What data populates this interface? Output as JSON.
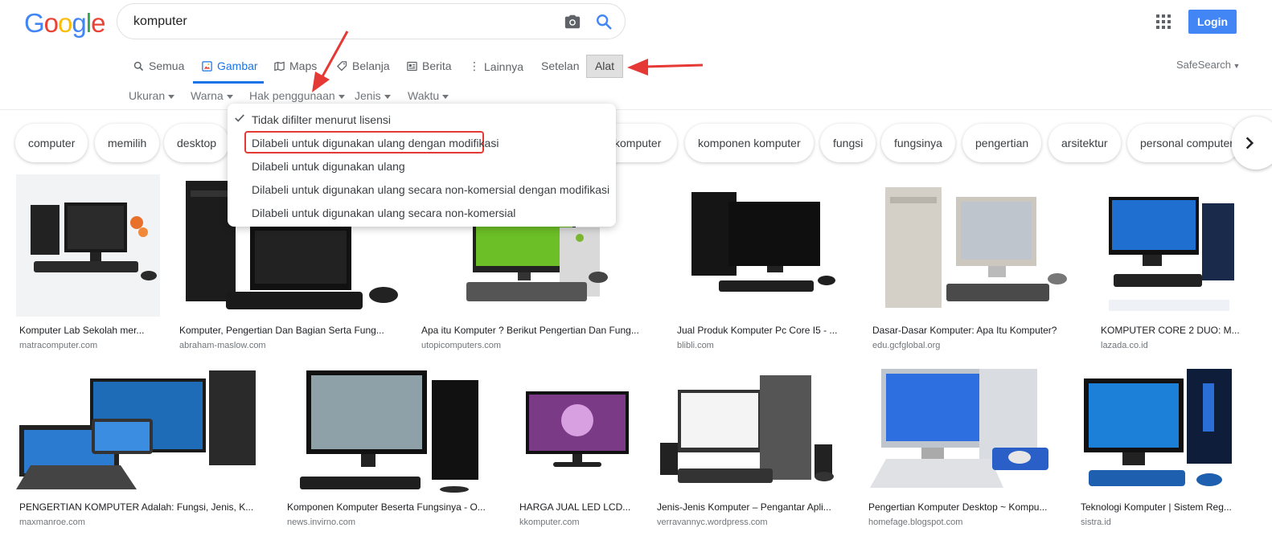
{
  "header": {
    "logo": "Google",
    "query": "komputer",
    "login_label": "Login"
  },
  "nav": {
    "tabs": [
      {
        "label": "Semua",
        "icon": "search-icon"
      },
      {
        "label": "Gambar",
        "icon": "image-icon",
        "active": true
      },
      {
        "label": "Maps",
        "icon": "map-icon"
      },
      {
        "label": "Belanja",
        "icon": "tag-icon"
      },
      {
        "label": "Berita",
        "icon": "news-icon"
      },
      {
        "label": "Lainnya",
        "icon": "more-icon"
      }
    ],
    "settings_label": "Setelan",
    "tools_label": "Alat",
    "safesearch_label": "SafeSearch"
  },
  "filters": [
    "Ukuran",
    "Warna",
    "Hak penggunaan",
    "Jenis",
    "Waktu"
  ],
  "chips": [
    "computer",
    "memilih",
    "desktop",
    "komputer",
    "komponen komputer",
    "fungsi",
    "fungsinya",
    "pengertian",
    "arsitektur",
    "personal computer"
  ],
  "dropdown": {
    "items": [
      {
        "label": "Tidak difilter menurut lisensi",
        "checked": true
      },
      {
        "label": "Dilabeli untuk digunakan ulang dengan modifikasi",
        "highlighted": true
      },
      {
        "label": "Dilabeli untuk digunakan ulang"
      },
      {
        "label": "Dilabeli untuk digunakan ulang secara non-komersial dengan modifikasi"
      },
      {
        "label": "Dilabeli untuk digunakan ulang secara non-komersial"
      }
    ]
  },
  "results_row1": [
    {
      "title": "Komputer Lab Sekolah mer...",
      "source": "matracomputer.com"
    },
    {
      "title": "Komputer, Pengertian Dan Bagian Serta Fung...",
      "source": "abraham-maslow.com"
    },
    {
      "title": "Apa itu Komputer ? Berikut Pengertian Dan Fung...",
      "source": "utopicomputers.com"
    },
    {
      "title": "Jual Produk Komputer Pc Core I5 - ...",
      "source": "blibli.com"
    },
    {
      "title": "Dasar-Dasar Komputer: Apa Itu Komputer?",
      "source": "edu.gcfglobal.org"
    },
    {
      "title": "KOMPUTER CORE 2 DUO: M...",
      "source": "lazada.co.id"
    }
  ],
  "results_row2": [
    {
      "title": "PENGERTIAN KOMPUTER Adalah: Fungsi, Jenis, K...",
      "source": "maxmanroe.com"
    },
    {
      "title": "Komponen Komputer Beserta Fungsinya - O...",
      "source": "news.invirno.com"
    },
    {
      "title": "HARGA JUAL LED LCD...",
      "source": "kkomputer.com"
    },
    {
      "title": "Jenis-Jenis Komputer – Pengantar Apli...",
      "source": "verravannyc.wordpress.com"
    },
    {
      "title": "Pengertian Komputer Desktop ~ Kompu...",
      "source": "homefage.blogspot.com"
    },
    {
      "title": "Teknologi Komputer | Sistem Reg...",
      "source": "sistra.id"
    }
  ],
  "colors": {
    "accent": "#1a73e8",
    "login": "#4285f4",
    "annotation": "#e53935"
  }
}
